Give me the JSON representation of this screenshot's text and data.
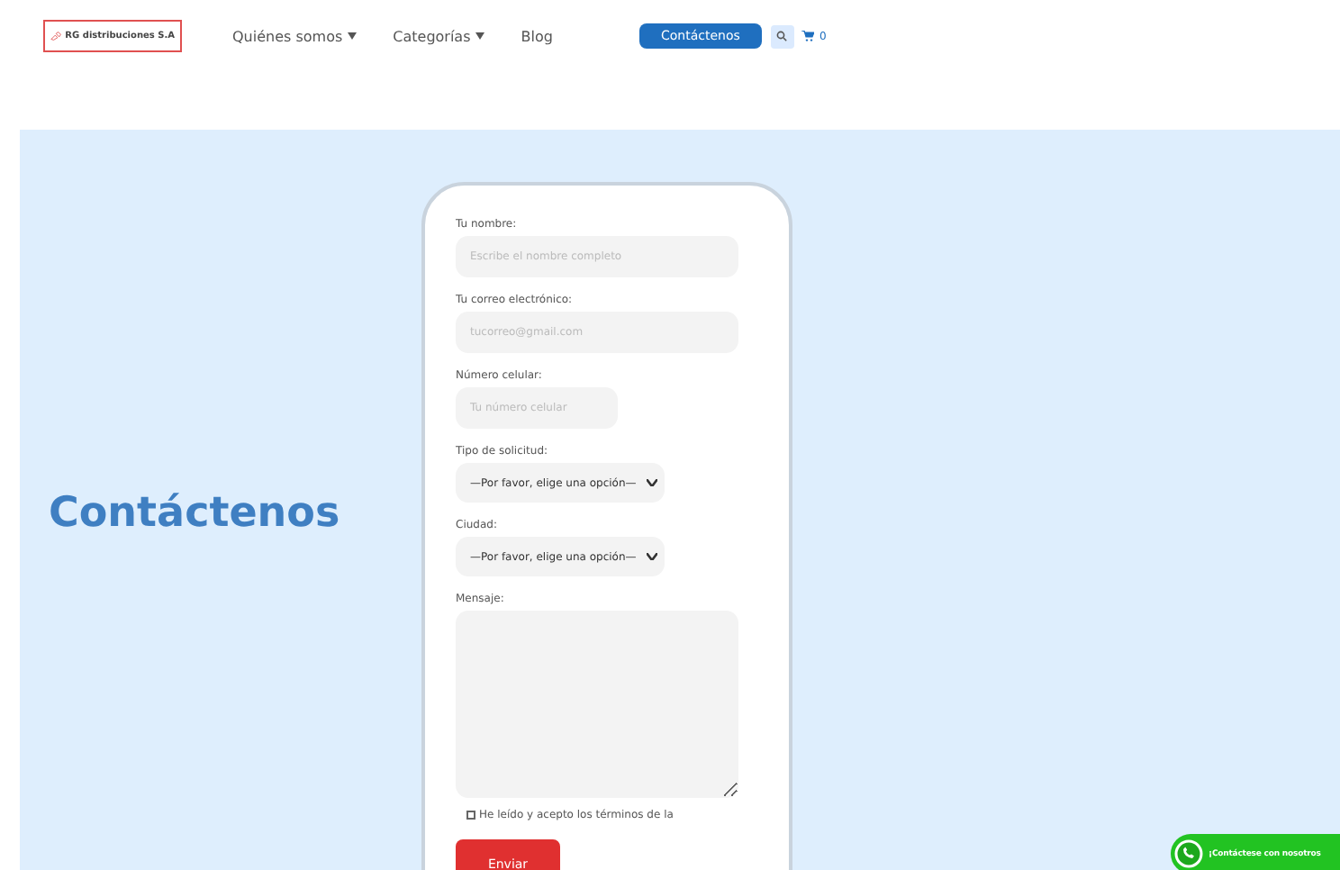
{
  "header": {
    "logo_text": "RG distribuciones S.A",
    "nav": [
      {
        "label": "Quiénes somos",
        "dropdown": true
      },
      {
        "label": "Categorías",
        "dropdown": true
      },
      {
        "label": "Blog",
        "dropdown": false
      }
    ],
    "cta": "Contáctenos",
    "cart_count": "0"
  },
  "hero": {
    "title": "Contáctenos"
  },
  "form": {
    "fields": [
      {
        "kind": "input",
        "label": "Tu nombre:",
        "placeholder": "Escribe el nombre completo"
      },
      {
        "kind": "input",
        "label": "Tu correo electrónico:",
        "placeholder": "tucorreo@gmail.com"
      },
      {
        "kind": "short_input",
        "label": "Número celular:",
        "placeholder": "Tu número celular"
      },
      {
        "kind": "select",
        "label": "Tipo de solicitud:",
        "value": "—Por favor, elige una opción—"
      },
      {
        "kind": "select",
        "label": "Ciudad:",
        "value": "—Por favor, elige una opción—"
      },
      {
        "kind": "textarea",
        "label": "Mensaje:"
      }
    ],
    "terms": {
      "label": "He leído y acepto los términos de la",
      "checked": false
    },
    "submit": "Enviar"
  },
  "whatsapp": {
    "label": "¡Contáctese con nosotros"
  }
}
